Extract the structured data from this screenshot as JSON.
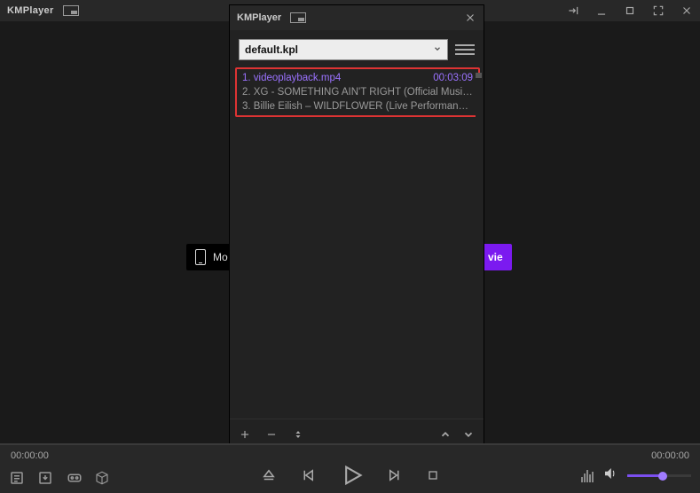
{
  "app": {
    "title": "KMPlayer"
  },
  "center": {
    "mobile_label": "Mo",
    "movie_label": "vie"
  },
  "playlist": {
    "title": "KMPlayer",
    "dropdown_value": "default.kpl",
    "items": [
      {
        "index": "1.",
        "title": "videoplayback.mp4",
        "duration": "00:03:09",
        "selected": true
      },
      {
        "index": "2.",
        "title": "XG - SOMETHING AIN'T RIGHT (Official Music Vi...",
        "duration": "",
        "selected": false
      },
      {
        "index": "3.",
        "title": "Billie Eilish – WILDFLOWER (Live Performance fro..",
        "duration": "",
        "selected": false
      }
    ]
  },
  "transport": {
    "time_left": "00:00:00",
    "time_right": "00:00:00"
  }
}
